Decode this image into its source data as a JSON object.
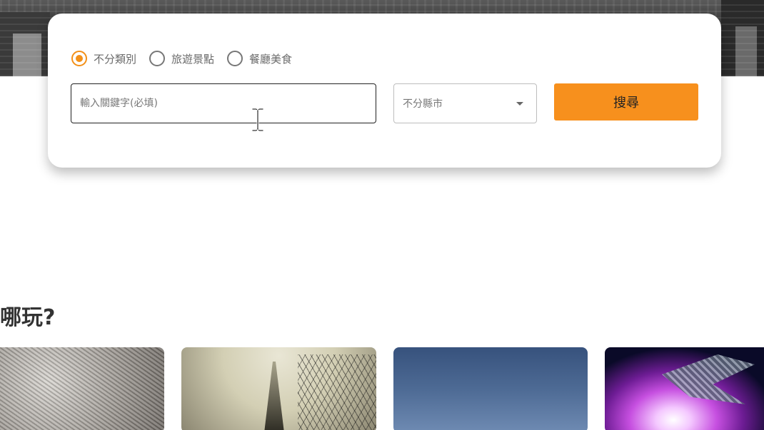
{
  "search": {
    "categories": [
      {
        "label": "不分類別",
        "checked": true
      },
      {
        "label": "旅遊景點",
        "checked": false
      },
      {
        "label": "餐廳美食",
        "checked": false
      }
    ],
    "keyword_placeholder": "輸入關鍵字(必填)",
    "keyword_value": "",
    "city_selected": "不分縣市",
    "search_button_label": "搜尋"
  },
  "section": {
    "title": "哪玩?"
  },
  "colors": {
    "accent": "#f7901d",
    "radio_checked": "#f39018",
    "card_background": "#ffffff"
  },
  "icons": {
    "city_dropdown": "chevron-down-icon",
    "cursor": "text-cursor-icon"
  }
}
